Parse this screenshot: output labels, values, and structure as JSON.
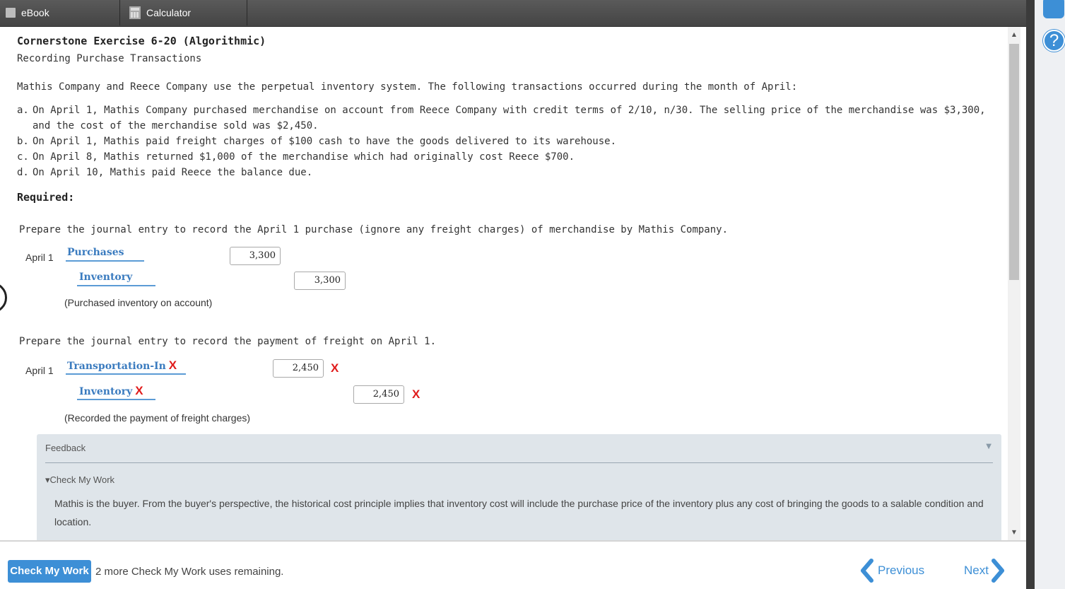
{
  "tabs": {
    "ebook": "eBook",
    "calculator": "Calculator"
  },
  "header": {
    "title": "Cornerstone Exercise 6-20 (Algorithmic)",
    "subtitle": "Recording Purchase Transactions"
  },
  "intro": "Mathis Company and Reece Company use the perpetual inventory system. The following transactions occurred during the month of April:",
  "transactions": [
    {
      "label": "a.",
      "text": "On April 1, Mathis Company purchased merchandise on account from Reece Company with credit terms of 2/10, n/30. The selling price of the merchandise was $3,300, and the cost of the merchandise sold was $2,450."
    },
    {
      "label": "b.",
      "text": "On April 1, Mathis paid freight charges of $100 cash to have the goods delivered to its warehouse."
    },
    {
      "label": "c.",
      "text": "On April 8, Mathis returned $1,000 of the merchandise which had originally cost Reece $700."
    },
    {
      "label": "d.",
      "text": "On April 10, Mathis paid Reece the balance due."
    }
  ],
  "required_label": "Required:",
  "entry1": {
    "question": "Prepare the journal entry to record the April 1 purchase (ignore any freight charges) of merchandise by Mathis Company.",
    "date": "April 1",
    "debit_account": "Purchases",
    "debit_amount": "3,300",
    "credit_account": "Inventory",
    "credit_amount": "3,300",
    "memo": "(Purchased inventory on account)"
  },
  "entry2": {
    "question": "Prepare the journal entry to record the payment of freight on April 1.",
    "date": "April 1",
    "debit_account": "Transportation-In",
    "debit_amount": "2,450",
    "credit_account": "Inventory",
    "credit_amount": "2,450",
    "memo": "(Recorded the payment of freight charges)",
    "incorrect_mark": "X"
  },
  "feedback": {
    "title": "Feedback",
    "check_label": "Check My Work",
    "text": "Mathis is the buyer. From the buyer's perspective, the historical cost principle implies that inventory cost will include the purchase price of the inventory plus any cost of bringing the goods to a salable condition and location."
  },
  "footer": {
    "check_button": "Check My Work",
    "remaining": "2 more Check My Work uses remaining.",
    "previous": "Previous",
    "next": "Next"
  },
  "side": {
    "help_glyph": "?"
  },
  "colors": {
    "accent": "#3d8fd6",
    "link": "#3a7bbf",
    "error": "#e01b1b",
    "feedback_bg": "#dfe5ea"
  }
}
